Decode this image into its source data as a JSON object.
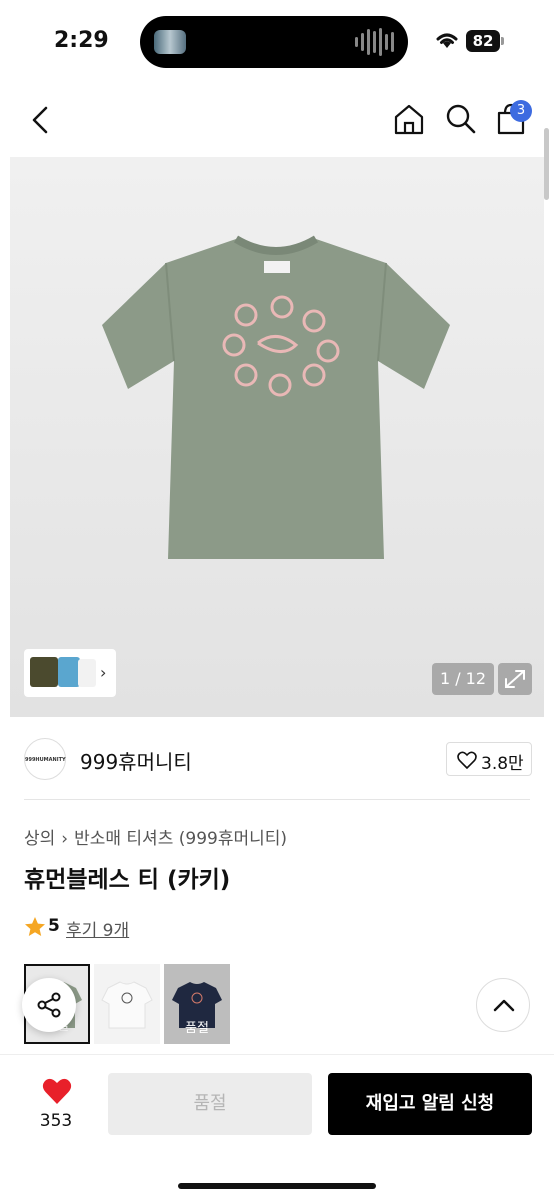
{
  "status_bar": {
    "time": "2:29",
    "battery": "82"
  },
  "nav": {
    "cart_count": "3"
  },
  "gallery": {
    "counter": "1 / 12"
  },
  "brand": {
    "logo_text": "999HUMANITY",
    "name": "999휴머니티",
    "likes": "3.8만"
  },
  "breadcrumb": {
    "level1": "상의",
    "level2": "반소매 티셔츠 (999휴머니티)"
  },
  "product": {
    "title": "휴먼블레스 티 (카키)",
    "rating": "5",
    "review_link": "후기 9개"
  },
  "options": [
    {
      "label": "품절",
      "color": "#8c9a88"
    },
    {
      "label": "",
      "color": "#f4f4f4"
    },
    {
      "label": "품절",
      "color": "#1f2840"
    }
  ],
  "bottom_bar": {
    "like_count": "353",
    "soldout_label": "품절",
    "restock_label": "재입고 알림 신청"
  },
  "colors": {
    "accent": "#3d6be0",
    "heart": "#e8202a",
    "star": "#f5a623",
    "shirt": "#8c9a88"
  }
}
